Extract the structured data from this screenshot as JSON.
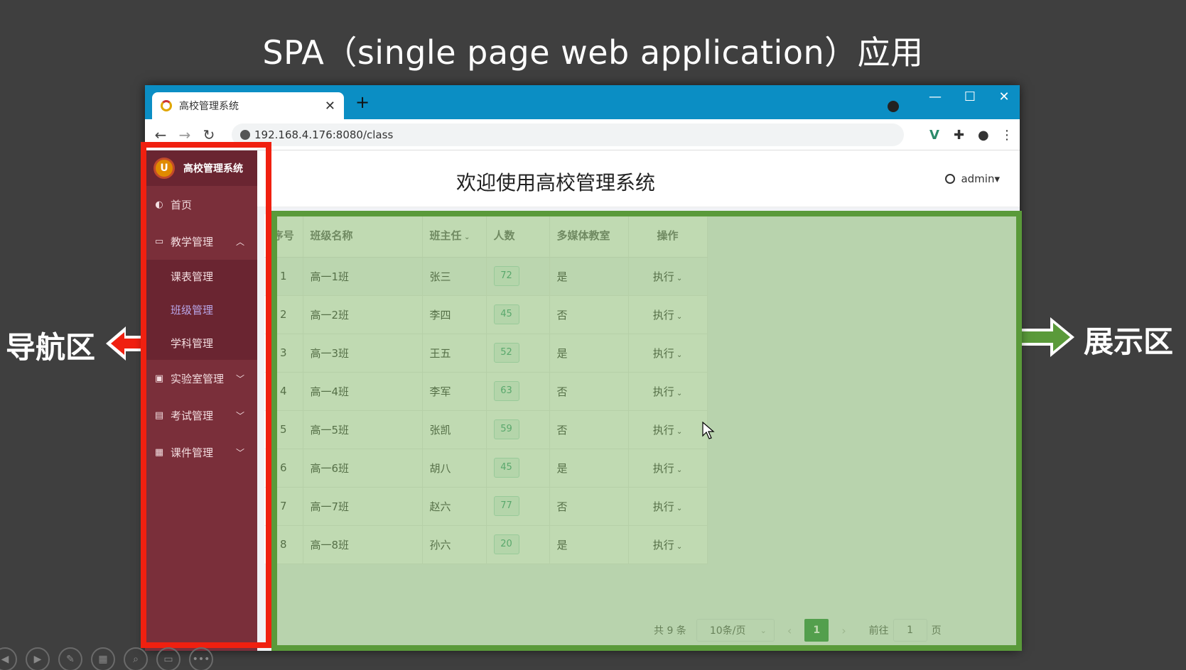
{
  "slide": {
    "title": "SPA（single page web application）应用",
    "nav_label": "导航区",
    "show_label": "展示区"
  },
  "browser": {
    "tab_title": "高校管理系统",
    "tab_close": "✕",
    "new_tab": "+",
    "url": "192.168.4.176:8080/class",
    "controls": {
      "minimize": "—",
      "maximize": "☐",
      "close": "✕"
    }
  },
  "sidebar": {
    "brand": "高校管理系统",
    "brand_logo": "U",
    "items": [
      {
        "label": "首页",
        "icon": "dashboard-icon",
        "glyph": "◐"
      },
      {
        "label": "教学管理",
        "icon": "monitor-icon",
        "glyph": "▭",
        "expanded": true,
        "children": [
          {
            "label": "课表管理"
          },
          {
            "label": "班级管理",
            "active": true
          },
          {
            "label": "学科管理"
          }
        ]
      },
      {
        "label": "实验室管理",
        "icon": "document-icon",
        "glyph": "▣"
      },
      {
        "label": "考试管理",
        "icon": "building-icon",
        "glyph": "▤"
      },
      {
        "label": "课件管理",
        "icon": "word-file-icon",
        "glyph": "▦"
      }
    ],
    "chevron_up": "︿",
    "chevron_down": "﹀"
  },
  "header": {
    "title": "欢迎使用高校管理系统",
    "user": "admin"
  },
  "table": {
    "columns": [
      "序号",
      "班级名称",
      "班主任",
      "人数",
      "多媒体教室",
      "操作"
    ],
    "rows": [
      {
        "idx": "1",
        "name": "高一1班",
        "teacher": "张三",
        "count": "72",
        "media": "是",
        "op": "执行"
      },
      {
        "idx": "2",
        "name": "高一2班",
        "teacher": "李四",
        "count": "45",
        "media": "否",
        "op": "执行"
      },
      {
        "idx": "3",
        "name": "高一3班",
        "teacher": "王五",
        "count": "52",
        "media": "是",
        "op": "执行"
      },
      {
        "idx": "4",
        "name": "高一4班",
        "teacher": "李军",
        "count": "63",
        "media": "否",
        "op": "执行"
      },
      {
        "idx": "5",
        "name": "高一5班",
        "teacher": "张凯",
        "count": "59",
        "media": "否",
        "op": "执行"
      },
      {
        "idx": "6",
        "name": "高一6班",
        "teacher": "胡八",
        "count": "45",
        "media": "是",
        "op": "执行"
      },
      {
        "idx": "7",
        "name": "高一7班",
        "teacher": "赵六",
        "count": "77",
        "media": "否",
        "op": "执行"
      },
      {
        "idx": "8",
        "name": "高一8班",
        "teacher": "孙六",
        "count": "20",
        "media": "是",
        "op": "执行"
      }
    ]
  },
  "pagination": {
    "total": "共 9 条",
    "page_size": "10条/页",
    "prev": "‹",
    "next": "›",
    "current_page": "1",
    "goto_prefix": "前往",
    "goto_value": "1",
    "goto_suffix": "页"
  },
  "colors": {
    "nav_highlight": "#f02010",
    "show_highlight": "#5a9a3a",
    "sidebar_bg": "#7a2f3a",
    "tab_bar": "#0b8ec4",
    "active_page": "#2f8f3f"
  }
}
